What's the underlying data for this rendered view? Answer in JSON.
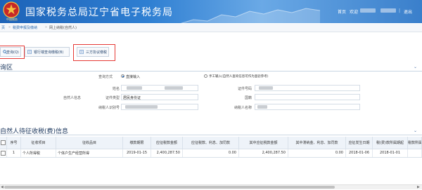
{
  "header": {
    "emblem_text": "中国税务",
    "title": "国家税务总局辽宁省电子税务局",
    "home_link": "首页",
    "welcome": "欢迎",
    "logout": "退出",
    "colors": {
      "bg": "#2f7fd2",
      "text": "#ffffff"
    }
  },
  "breadcrumb": {
    "items": [
      "页",
      "税费申报及缴纳",
      "网上纳税(自然人)"
    ],
    "separators": [
      "»",
      "»"
    ]
  },
  "toolbar": {
    "buttons": [
      {
        "label": "查询(Q)",
        "icon": "search-icon"
      },
      {
        "label": "银行端查询缴税(B)",
        "icon": "bank-icon"
      },
      {
        "label": "三方协议缴税",
        "icon": "agreement-icon"
      }
    ]
  },
  "section1": {
    "title": "询区"
  },
  "form": {
    "query_mode_label": "查询方式",
    "mode_options": [
      {
        "label": "直接输入",
        "selected": true
      },
      {
        "label": "手工输入(自然人查询信息可作为查验参考)",
        "selected": false
      }
    ],
    "name_label": "姓名",
    "id_number_label": "证件号码",
    "group_label": "自然人信息",
    "id_type_label": "证件类型",
    "id_type_value": "居民身份证",
    "nationality_label": "国籍",
    "taxpayer_id_label": "纳税人识别号",
    "taxpayer_name_label": "纳税人名称"
  },
  "section2": {
    "title": "自然人待征收税(费)信息"
  },
  "table": {
    "headers": [
      "",
      "序号",
      "征收项目",
      "征收品目",
      "缴款期限",
      "应征税款金额",
      "应征税款、利息、加罚款",
      "其中应征税款金额",
      "其中滞纳金、利息、加罚款",
      "应征发生日期",
      "税(费)款所属期起",
      "税款所属期止"
    ],
    "rows": [
      {
        "checked": false,
        "index": "1",
        "item": "个人所得税",
        "subitem": "个体户生产经营所得",
        "deadline": "2019-01-15",
        "amount": "2,400,287.50",
        "amount2": "0.00",
        "amount3": "2,400,287.50",
        "amount4": "0.00",
        "occur_date": "2018-01-06",
        "period_start": "2018-01-01",
        "period_end": ""
      }
    ]
  }
}
